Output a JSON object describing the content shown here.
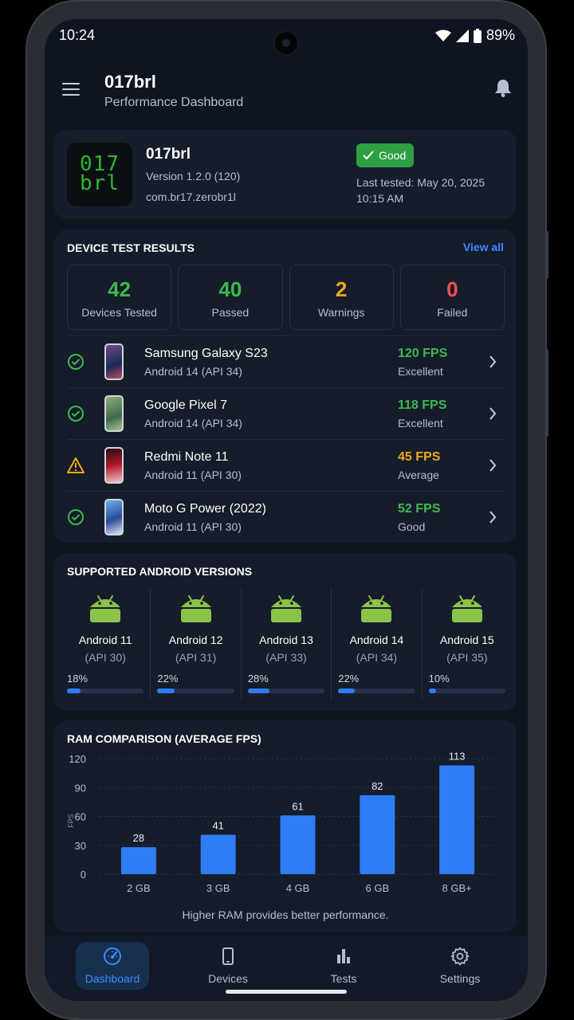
{
  "status_bar": {
    "time": "10:24",
    "battery": "89%"
  },
  "app_bar": {
    "title": "017brl",
    "subtitle": "Performance Dashboard"
  },
  "app_info": {
    "logo_text_line1": "017",
    "logo_text_line2": "brl",
    "name": "017brl",
    "version": "Version 1.2.0 (120)",
    "package": "com.br17.zerobr1l",
    "status": "Good",
    "last_tested_line1": "Last tested: May 20, 2025",
    "last_tested_line2": "10:15 AM"
  },
  "device_results": {
    "title": "DEVICE TEST RESULTS",
    "view_all": "View all",
    "stats": [
      {
        "value": "42",
        "label": "Devices Tested",
        "color": "#3fb950"
      },
      {
        "value": "40",
        "label": "Passed",
        "color": "#3fb950"
      },
      {
        "value": "2",
        "label": "Warnings",
        "color": "#f0a818"
      },
      {
        "value": "0",
        "label": "Failed",
        "color": "#f85149"
      }
    ],
    "devices": [
      {
        "name": "Samsung Galaxy S23",
        "os": "Android 14 (API 34)",
        "fps": "120 FPS",
        "rating": "Excellent",
        "status_icon": "check-circle-icon",
        "color": "#3fb950"
      },
      {
        "name": "Google Pixel 7",
        "os": "Android 14 (API 34)",
        "fps": "118 FPS",
        "rating": "Excellent",
        "status_icon": "check-circle-icon",
        "color": "#3fb950"
      },
      {
        "name": "Redmi Note 11",
        "os": "Android 11 (API 30)",
        "fps": "45 FPS",
        "rating": "Average",
        "status_icon": "warning-icon",
        "color": "#f0a818"
      },
      {
        "name": "Moto G Power (2022)",
        "os": "Android 11 (API 30)",
        "fps": "52 FPS",
        "rating": "Good",
        "status_icon": "check-circle-icon",
        "color": "#3fb950"
      }
    ]
  },
  "android_versions": {
    "title": "SUPPORTED ANDROID VERSIONS",
    "items": [
      {
        "name": "Android 11",
        "api": "(API 30)",
        "percent_label": "18%",
        "percent": 18
      },
      {
        "name": "Android 12",
        "api": "(API 31)",
        "percent_label": "22%",
        "percent": 22
      },
      {
        "name": "Android 13",
        "api": "(API 33)",
        "percent_label": "28%",
        "percent": 28
      },
      {
        "name": "Android 14",
        "api": "(API 34)",
        "percent_label": "22%",
        "percent": 22
      },
      {
        "name": "Android 15",
        "api": "(API 35)",
        "percent_label": "10%",
        "percent": 10
      }
    ]
  },
  "ram_comparison": {
    "title": "RAM COMPARISON (AVERAGE FPS)",
    "footnote": "Higher RAM provides better performance."
  },
  "chart_data": {
    "type": "bar",
    "title": "RAM COMPARISON (AVERAGE FPS)",
    "categories": [
      "2 GB",
      "3 GB",
      "4 GB",
      "6 GB",
      "8 GB+"
    ],
    "values": [
      28,
      41,
      61,
      82,
      113
    ],
    "ylabel": "FPS",
    "xlabel": "",
    "ylim": [
      0,
      120
    ],
    "yticks": [
      0,
      30,
      60,
      90,
      120
    ],
    "grid": true,
    "bar_color": "#2f7cf6"
  },
  "bottom_nav": [
    {
      "label": "Dashboard",
      "icon": "speedometer-icon",
      "active": true
    },
    {
      "label": "Devices",
      "icon": "phone-icon",
      "active": false
    },
    {
      "label": "Tests",
      "icon": "bar-chart-icon",
      "active": false
    },
    {
      "label": "Settings",
      "icon": "gear-icon",
      "active": false
    }
  ],
  "colors": {
    "accent": "#3d8bff",
    "good": "#3fb950",
    "warning": "#f0a818",
    "failed": "#f85149",
    "background": "#0e1420",
    "card": "#151c2a"
  }
}
